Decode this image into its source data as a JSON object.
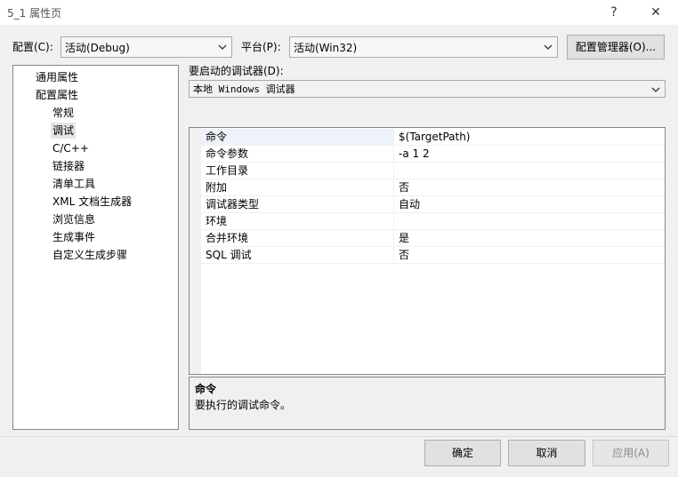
{
  "window": {
    "title": "5_1 属性页",
    "help_glyph": "?",
    "close_glyph": "✕"
  },
  "config": {
    "label": "配置(C):",
    "value": "活动(Debug)"
  },
  "platform": {
    "label": "平台(P):",
    "value": "活动(Win32)"
  },
  "config_manager_button": "配置管理器(O)...",
  "tree": {
    "items": [
      {
        "label": "通用属性"
      },
      {
        "label": "配置属性"
      },
      {
        "label": "常规"
      },
      {
        "label": "调试"
      },
      {
        "label": "C/C++"
      },
      {
        "label": "链接器"
      },
      {
        "label": "清单工具"
      },
      {
        "label": "XML 文档生成器"
      },
      {
        "label": "浏览信息"
      },
      {
        "label": "生成事件"
      },
      {
        "label": "自定义生成步骤"
      }
    ]
  },
  "debugger": {
    "label": "要启动的调试器(D):",
    "value": "本地 Windows 调试器"
  },
  "grid": {
    "rows": [
      {
        "key": "命令",
        "value": "$(TargetPath)"
      },
      {
        "key": "命令参数",
        "value": "-a 1 2"
      },
      {
        "key": "工作目录",
        "value": ""
      },
      {
        "key": "附加",
        "value": "否"
      },
      {
        "key": "调试器类型",
        "value": "自动"
      },
      {
        "key": "环境",
        "value": ""
      },
      {
        "key": "合并环境",
        "value": "是"
      },
      {
        "key": "SQL 调试",
        "value": "否"
      }
    ]
  },
  "description": {
    "heading": "命令",
    "text": "要执行的调试命令。"
  },
  "buttons": {
    "ok": "确定",
    "cancel": "取消",
    "apply": "应用(A)"
  }
}
